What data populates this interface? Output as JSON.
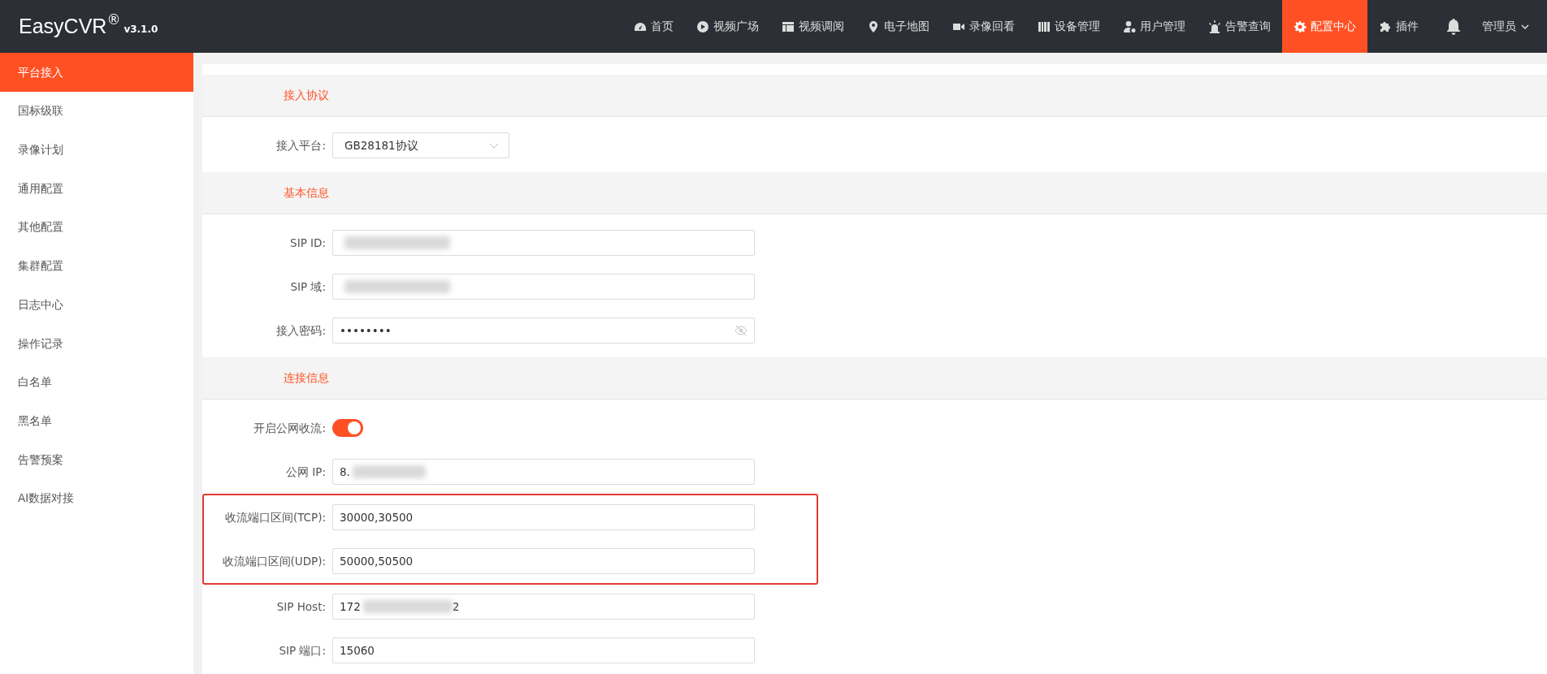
{
  "brand": {
    "name": "EasyCVR",
    "mark": "®",
    "version": "v3.1.0"
  },
  "nav": [
    {
      "label": "首页",
      "selected": false
    },
    {
      "label": "视频广场",
      "selected": false
    },
    {
      "label": "视频调阅",
      "selected": false
    },
    {
      "label": "电子地图",
      "selected": false
    },
    {
      "label": "录像回看",
      "selected": false
    },
    {
      "label": "设备管理",
      "selected": false
    },
    {
      "label": "用户管理",
      "selected": false
    },
    {
      "label": "告警查询",
      "selected": false
    },
    {
      "label": "配置中心",
      "selected": true
    },
    {
      "label": "插件",
      "selected": false
    }
  ],
  "user": {
    "label": "管理员"
  },
  "sidebar": {
    "items": [
      {
        "label": "平台接入",
        "selected": true
      },
      {
        "label": "国标级联",
        "selected": false
      },
      {
        "label": "录像计划",
        "selected": false
      },
      {
        "label": "通用配置",
        "selected": false
      },
      {
        "label": "其他配置",
        "selected": false
      },
      {
        "label": "集群配置",
        "selected": false
      },
      {
        "label": "日志中心",
        "selected": false
      },
      {
        "label": "操作记录",
        "selected": false
      },
      {
        "label": "白名单",
        "selected": false
      },
      {
        "label": "黑名单",
        "selected": false
      },
      {
        "label": "告警预案",
        "selected": false
      },
      {
        "label": "AI数据对接",
        "selected": false
      }
    ]
  },
  "sections": [
    {
      "title": "接入协议",
      "fields": [
        {
          "kind": "select",
          "label": "接入平台:",
          "value": "GB28181协议",
          "highlighted": false
        }
      ]
    },
    {
      "title": "基本信息",
      "fields": [
        {
          "kind": "text",
          "label": "SIP ID:",
          "redacted": true,
          "highlighted": false
        },
        {
          "kind": "text",
          "label": "SIP 域:",
          "redacted": true,
          "highlighted": false
        },
        {
          "kind": "password",
          "label": "接入密码:",
          "value": "••••••••",
          "highlighted": false
        }
      ]
    },
    {
      "title": "连接信息",
      "fields": [
        {
          "kind": "switch",
          "label": "开启公网收流:",
          "on": true,
          "highlighted": false
        },
        {
          "kind": "text",
          "label": "公网 IP:",
          "value": "8.",
          "redacted": true,
          "highlighted": false
        },
        {
          "kind": "text",
          "label": "收流端口区间(TCP):",
          "value": "30000,30500",
          "highlighted": true
        },
        {
          "kind": "text",
          "label": "收流端口区间(UDP):",
          "value": "50000,50500",
          "highlighted": true
        },
        {
          "kind": "text",
          "label": "SIP Host:",
          "value": "172",
          "value_end": "2",
          "redacted": true,
          "highlighted": false
        },
        {
          "kind": "text",
          "label": "SIP 端口:",
          "value": "15060",
          "highlighted": false
        }
      ]
    }
  ]
}
